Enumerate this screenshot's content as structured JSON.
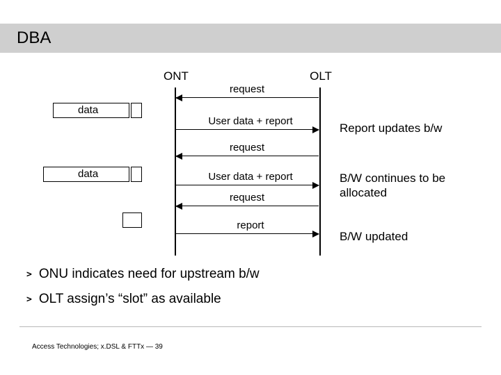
{
  "title": "DBA",
  "ont_label": "ONT",
  "olt_label": "OLT",
  "data_label_1": "data",
  "data_label_2": "data",
  "arrows": {
    "a1": "request",
    "a2": "User data + report",
    "a3": "request",
    "a4": "User data + report",
    "a5": "request",
    "a6": "report"
  },
  "annotations": {
    "r1": "Report updates b/w",
    "r2": "B/W continues to be allocated",
    "r3": "B/W updated"
  },
  "bullets": [
    "ONU indicates need for upstream b/w",
    "OLT assign’s “slot” as available"
  ],
  "footer": "Access Technologies; x.DSL & FTTx — 39"
}
